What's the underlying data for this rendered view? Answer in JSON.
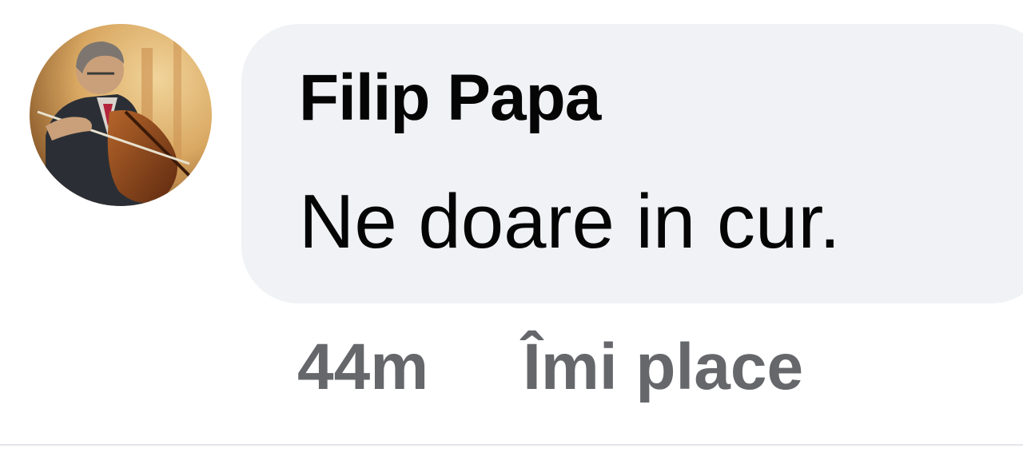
{
  "comment": {
    "author": "Filip Papa",
    "text": "Ne doare in cur.",
    "time": "44m",
    "like_label": "Îmi place",
    "avatar_icon": "profile-photo-cellist"
  },
  "colors": {
    "bubble_background": "#f0f2f5",
    "primary_text": "#050505",
    "secondary_text": "#65676b",
    "divider": "#e4e6eb"
  }
}
